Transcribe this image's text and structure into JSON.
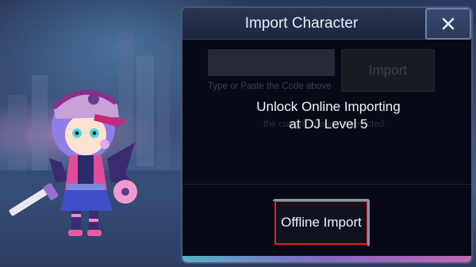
{
  "dialog": {
    "title": "Import Character",
    "close_label": "X",
    "code_input": {
      "value": "",
      "placeholder": ""
    },
    "import_label": "Import",
    "hint": "Type or Paste the Code above",
    "sub_hint": "the current character selected.",
    "unlock_line1": "Unlock Online Importing",
    "unlock_line2": "at DJ Level 5",
    "offline_import_label": "Offline Import"
  },
  "colors": {
    "highlight": "#e0232b",
    "dialog_bg": "#070a16",
    "header_bg": "#2a3452"
  },
  "icons": {
    "close": "close-icon",
    "character": "character-figure"
  }
}
